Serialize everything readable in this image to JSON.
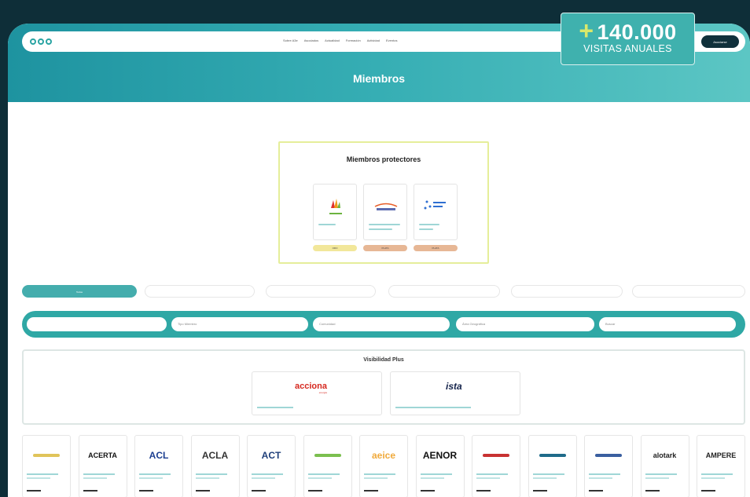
{
  "nav": {
    "links": [
      "Sobre A3e",
      "Asociados",
      "Actualidad",
      "Formación",
      "Actividad",
      "Eventos"
    ],
    "join_label": "Asociarse"
  },
  "page": {
    "title": "Miembros"
  },
  "protectors": {
    "title": "Miembros protectores",
    "cards": [
      {
        "name": "Iberdrola",
        "badge": "ORO",
        "badge_color": "#f2e79a"
      },
      {
        "name": "Repsol",
        "badge": "PLATA",
        "badge_color": "#e7b795"
      },
      {
        "name": "EDP",
        "badge": "PLATA",
        "badge_color": "#e7b795"
      }
    ]
  },
  "filter_tabs": [
    "Todos",
    "",
    "",
    "",
    "",
    ""
  ],
  "search_fields": [
    "",
    "Tipo Miembro",
    "Comunidad",
    "Área Geográfica",
    "Buscar"
  ],
  "visibility_plus": {
    "title": "Visibilidad Plus",
    "cards": [
      {
        "logo": "acciona",
        "sub": "energía"
      },
      {
        "logo": "ista"
      }
    ]
  },
  "members": [
    {
      "logo": "",
      "color": "#e0c45a"
    },
    {
      "logo": "ACERTA",
      "color": "#111111"
    },
    {
      "logo": "ACL",
      "color": "#1c3f91"
    },
    {
      "logo": "ACLA",
      "color": "#333333"
    },
    {
      "logo": "ACT",
      "color": "#1f3f7a"
    },
    {
      "logo": "",
      "color": "#7bbf4f"
    },
    {
      "logo": "aeice",
      "color": "#f0a93a"
    },
    {
      "logo": "AENOR",
      "color": "#111111"
    },
    {
      "logo": "",
      "color": "#c83232"
    },
    {
      "logo": "",
      "color": "#1f6b8a"
    },
    {
      "logo": "",
      "color": "#3a5fa0"
    },
    {
      "logo": "alotark",
      "color": "#222222"
    },
    {
      "logo": "AMPERE",
      "color": "#222222"
    }
  ],
  "promo": {
    "plus": "+",
    "number": "140.000",
    "label": "VISITAS ANUALES"
  },
  "colors": {
    "teal": "#2fa8a5",
    "dark": "#0e2e38",
    "accent": "#d9e86b"
  }
}
